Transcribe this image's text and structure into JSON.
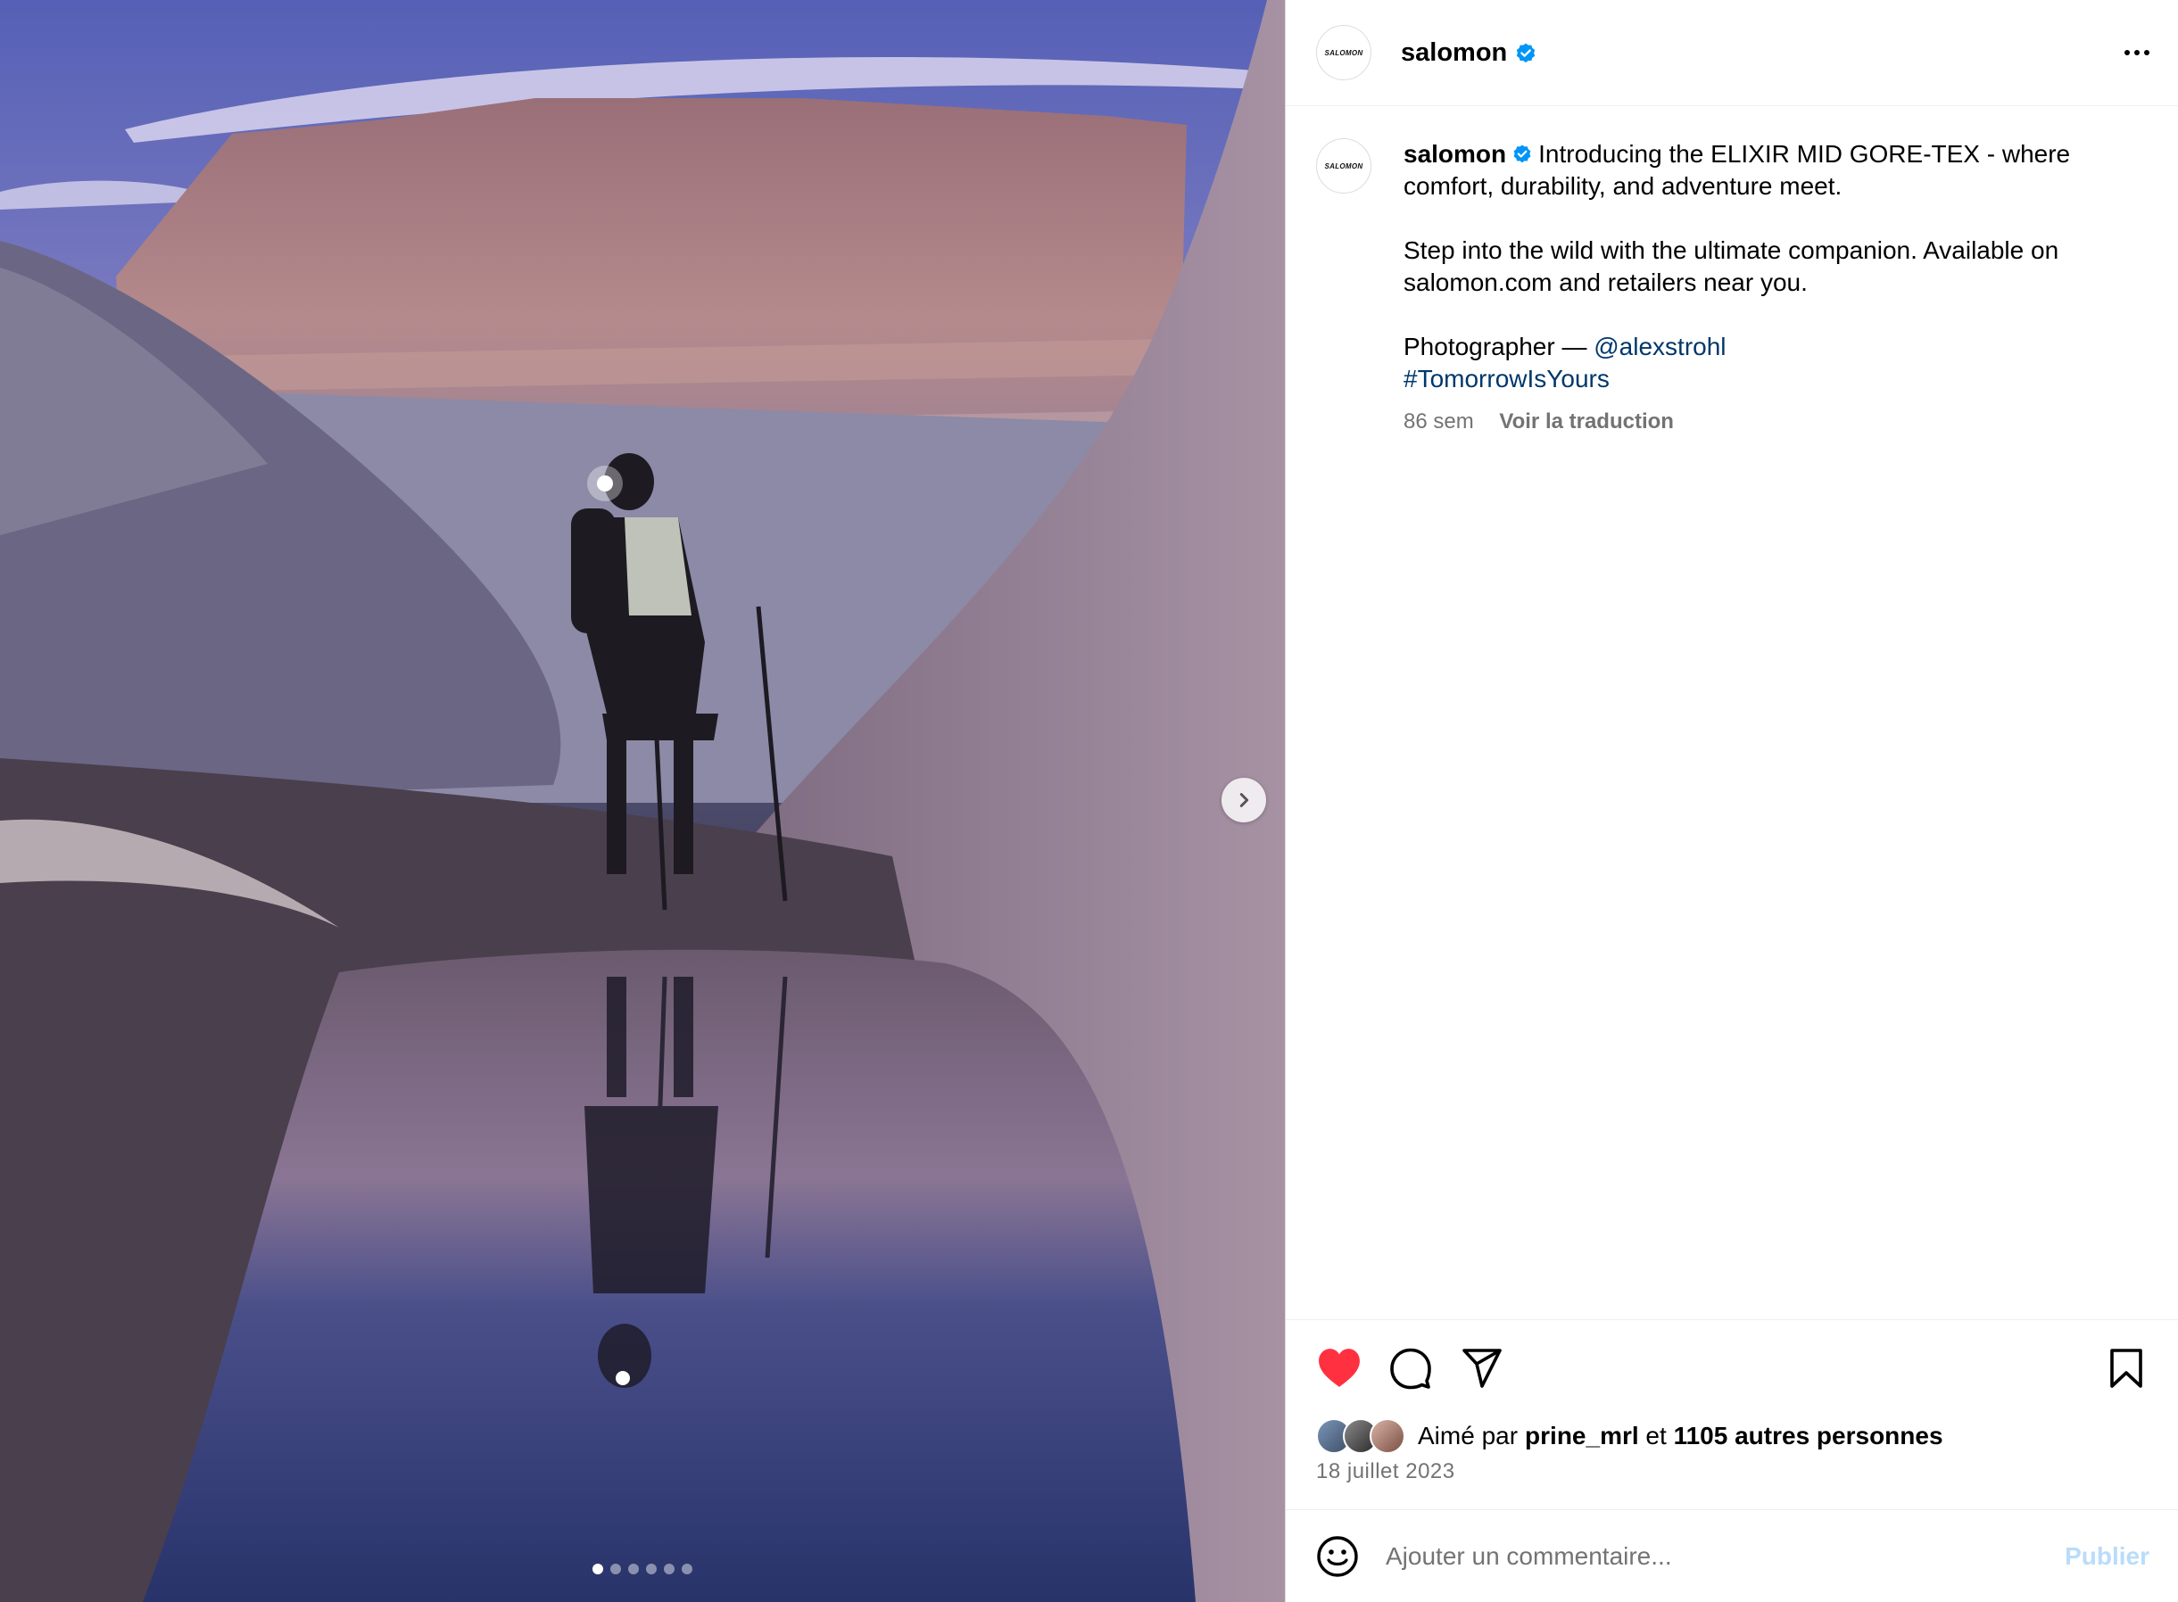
{
  "post": {
    "author": "salomon",
    "avatar_logo": "SALOMON",
    "verified": true
  },
  "caption": {
    "author": "salomon",
    "line1": "Introducing the ELIXIR MID GORE-TEX - where comfort, durability, and adventure meet.",
    "line2": "Step into the wild with the ultimate companion. Available on salomon.com and retailers near you.",
    "photographer_prefix": "Photographer — ",
    "photographer_handle": "@alexstrohl",
    "hashtag": "#TomorrowIsYours",
    "age": "86 sem",
    "translate_label": "Voir la traduction"
  },
  "actions": {
    "like_icon": "heart-filled-icon",
    "comment_icon": "comment-icon",
    "share_icon": "paper-plane-icon",
    "save_icon": "bookmark-icon",
    "liked": true,
    "like_color": "#ff3040"
  },
  "likes": {
    "prefix": "Aimé par ",
    "first_liker": "prine_mrl",
    "conjunction": " et ",
    "others": "1105 autres personnes"
  },
  "date": "18 juillet 2023",
  "comment": {
    "placeholder": "Ajouter un commentaire...",
    "emoji_icon": "smiley-icon",
    "publish_label": "Publier"
  },
  "carousel": {
    "slide_count": 6,
    "active_index": 0,
    "next_icon": "chevron-right-icon"
  },
  "colors": {
    "link": "#00376b",
    "verified": "#0095f6",
    "muted": "#737373",
    "publish_disabled": "#b9dcfb"
  }
}
